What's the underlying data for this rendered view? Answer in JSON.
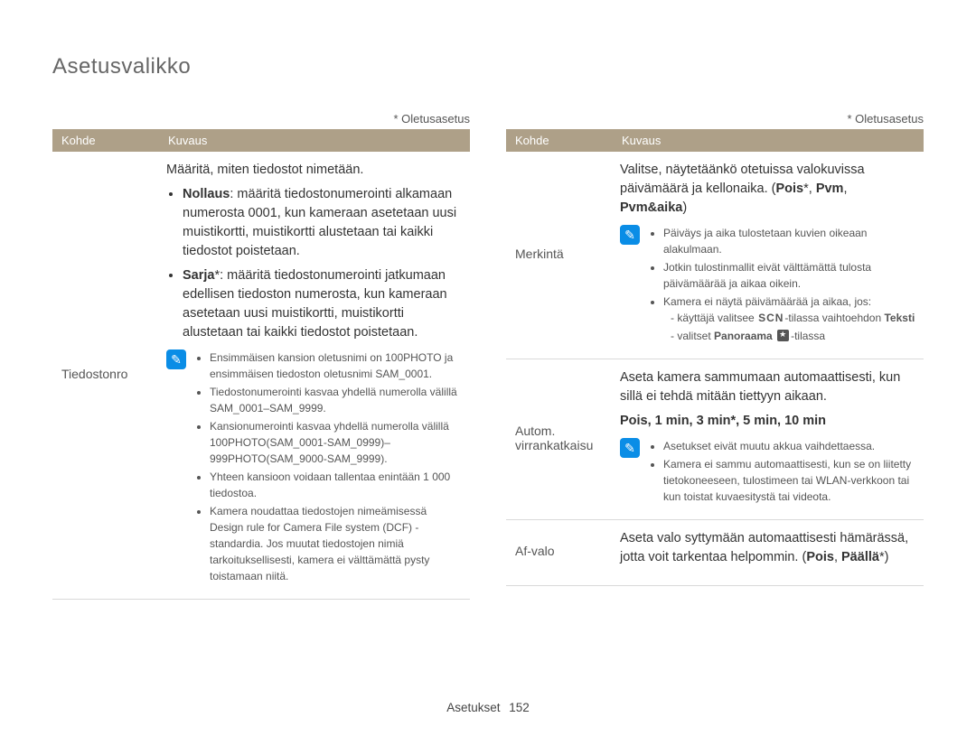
{
  "page_title": "Asetusvalikko",
  "default_label": "* Oletusasetus",
  "headers": {
    "col1": "Kohde",
    "col2": "Kuvaus"
  },
  "footer": {
    "section": "Asetukset",
    "page": "152"
  },
  "left": {
    "row1": {
      "label": "Tiedostonro",
      "intro": "Määritä, miten tiedostot nimetään.",
      "b1_bold": "Nollaus",
      "b1_rest": ": määritä tiedostonumerointi alkamaan numerosta 0001, kun kameraan asetetaan uusi muistikortti, muistikortti alustetaan tai kaikki tiedostot poistetaan.",
      "b2_bold": "Sarja",
      "b2_rest": "*: määritä tiedostonumerointi jatkumaan edellisen tiedoston numerosta, kun kameraan asetetaan uusi muistikortti, muistikortti alustetaan tai kaikki tiedostot poistetaan.",
      "notes": [
        "Ensimmäisen kansion oletusnimi on 100PHOTO ja ensimmäisen tiedoston oletusnimi SAM_0001.",
        "Tiedostonumerointi kasvaa yhdellä numerolla välillä SAM_0001–SAM_9999.",
        "Kansionumerointi kasvaa yhdellä numerolla välillä 100PHOTO(SAM_0001-SAM_0999)–999PHOTO(SAM_9000-SAM_9999).",
        "Yhteen kansioon voidaan tallentaa enintään 1 000 tiedostoa.",
        "Kamera noudattaa tiedostojen nimeämisessä Design rule for Camera File system (DCF) -standardia. Jos muutat tiedostojen nimiä tarkoituksellisesti, kamera ei välttämättä pysty toistamaan niitä."
      ]
    }
  },
  "right": {
    "row1": {
      "label": "Merkintä",
      "intro_a": "Valitse, näytetäänkö otetuissa valokuvissa päivämäärä ja kellonaika. (",
      "opt1": "Pois",
      "optsep": "*, ",
      "opt2": "Pvm",
      "optsep2": ", ",
      "opt3": "Pvm&aika",
      "intro_close": ")",
      "notes": [
        "Päiväys ja aika tulostetaan kuvien oikeaan alakulmaan.",
        "Jotkin tulostinmallit eivät välttämättä tulosta päivämäärää ja aikaa oikein.",
        "Kamera ei näytä päivämäärää ja aikaa, jos:"
      ],
      "sub_a1": "käyttäjä valitsee ",
      "sub_a2": "-tilassa vaihtoehdon ",
      "sub_a_bold": "Teksti",
      "sub_b1": "valitset ",
      "sub_b_bold": "Panoraama ",
      "sub_b2": "-tilassa",
      "scn": "SCN"
    },
    "row2": {
      "label": "Autom. virrankatkaisu",
      "intro": "Aseta kamera sammumaan automaattisesti, kun sillä ei tehdä mitään tiettyyn aikaan.",
      "options": "Pois, 1 min, 3 min*, 5 min, 10 min",
      "notes": [
        "Asetukset eivät muutu akkua vaihdettaessa.",
        "Kamera ei sammu automaattisesti, kun se on liitetty tietokoneeseen, tulostimeen tai WLAN-verkkoon tai kun toistat kuvaesitystä tai videota."
      ]
    },
    "row3": {
      "label": "Af-valo",
      "intro_a": "Aseta valo syttymään automaattisesti hämärässä, jotta voit tarkentaa helpommin. (",
      "opt1": "Pois",
      "optsep": ", ",
      "opt2": "Päällä",
      "intro_close": "*)"
    }
  }
}
